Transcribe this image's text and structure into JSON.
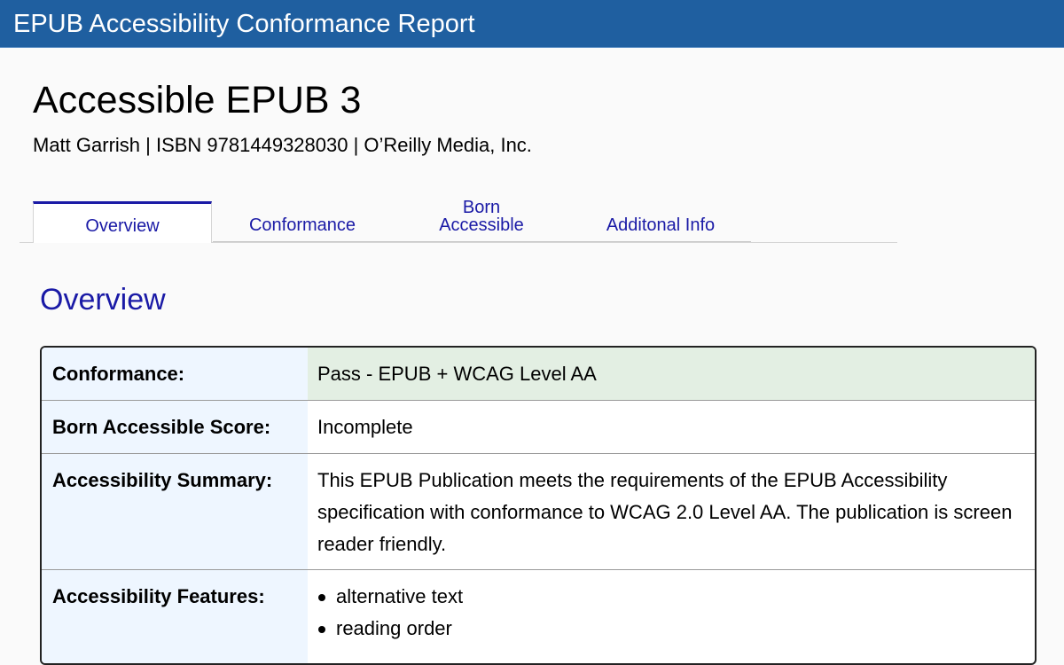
{
  "app": {
    "header_title": "EPUB Accessibility Conformance Report"
  },
  "book": {
    "title": "Accessible EPUB 3",
    "byline": "Matt Garrish | ISBN 9781449328030 | O’Reilly Media, Inc."
  },
  "tabs": [
    {
      "label": "Overview",
      "active": true
    },
    {
      "label": "Conformance",
      "active": false
    },
    {
      "label": "Born\nAccessible",
      "active": false
    },
    {
      "label": "Additonal Info",
      "active": false
    }
  ],
  "section": {
    "title": "Overview"
  },
  "report": {
    "rows": [
      {
        "label": "Conformance:",
        "value": "Pass - EPUB + WCAG Level AA"
      },
      {
        "label": "Born Accessible Score:",
        "value": "Incomplete"
      },
      {
        "label": "Accessibility Summary:",
        "value": "This EPUB Publication meets the requirements of the EPUB Accessibility specification with conformance to WCAG 2.0 Level AA. The publication is screen reader friendly."
      },
      {
        "label": "Accessibility Features:",
        "features": [
          "alternative text",
          "reading order"
        ]
      }
    ]
  },
  "colors": {
    "header_bg": "#1f5fa0",
    "link": "#1a1aa6",
    "label_bg": "#eef6ff",
    "pass_bg": "#e3efe3"
  }
}
